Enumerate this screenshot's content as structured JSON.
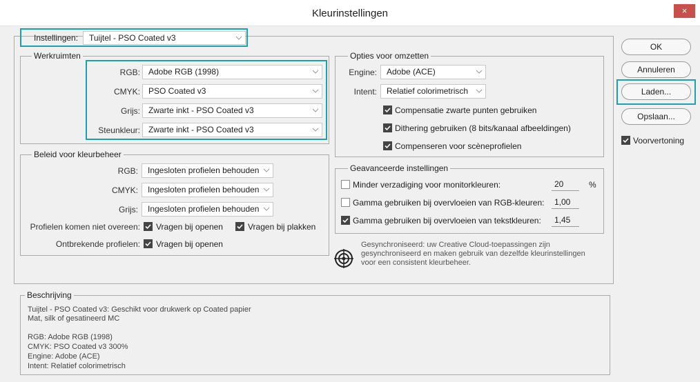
{
  "window": {
    "title": "Kleurinstellingen",
    "close_glyph": "×"
  },
  "settings": {
    "label": "Instellingen:",
    "value": "Tuijtel - PSO Coated v3"
  },
  "workspaces": {
    "title": "Werkruimten",
    "rows": [
      {
        "label": "RGB:",
        "value": "Adobe RGB (1998)"
      },
      {
        "label": "CMYK:",
        "value": "PSO Coated v3"
      },
      {
        "label": "Grijs:",
        "value": "Zwarte inkt - PSO Coated v3"
      },
      {
        "label": "Steunkleur:",
        "value": "Zwarte inkt - PSO Coated v3"
      }
    ]
  },
  "policy": {
    "title": "Beleid voor kleurbeheer",
    "rows": [
      {
        "label": "RGB:",
        "value": "Ingesloten profielen behouden"
      },
      {
        "label": "CMYK:",
        "value": "Ingesloten profielen behouden"
      },
      {
        "label": "Grijs:",
        "value": "Ingesloten profielen behouden"
      }
    ],
    "mismatch_label": "Profielen komen niet overeen:",
    "mismatch_open": {
      "label": "Vragen bij openen",
      "checked": true
    },
    "mismatch_paste": {
      "label": "Vragen bij plakken",
      "checked": true
    },
    "missing_label": "Ontbrekende profielen:",
    "missing_open": {
      "label": "Vragen bij openen",
      "checked": true
    }
  },
  "conversion": {
    "title": "Opties voor omzetten",
    "engine_label": "Engine:",
    "engine_value": "Adobe (ACE)",
    "intent_label": "Intent:",
    "intent_value": "Relatief colorimetrisch",
    "checks": [
      {
        "label": "Compensatie zwarte punten gebruiken",
        "checked": true
      },
      {
        "label": "Dithering gebruiken (8 bits/kanaal afbeeldingen)",
        "checked": true
      },
      {
        "label": "Compenseren voor scèneprofielen",
        "checked": true
      }
    ]
  },
  "advanced": {
    "title": "Geavanceerde instellingen",
    "rows": [
      {
        "label": "Minder verzadiging voor monitorkleuren:",
        "value": "20",
        "unit": "%",
        "checked": false
      },
      {
        "label": "Gamma gebruiken bij overvloeien van RGB-kleuren:",
        "value": "1,00",
        "unit": "",
        "checked": false
      },
      {
        "label": "Gamma gebruiken bij overvloeien van tekstkleuren:",
        "value": "1,45",
        "unit": "",
        "checked": true
      }
    ]
  },
  "sync": {
    "icon": "sync-target-icon",
    "lines": [
      "Gesynchroniseerd: uw Creative Cloud-toepassingen zijn",
      "gesynchroniseerd en maken gebruik van dezelfde kleurinstellingen",
      "voor een consistent kleurbeheer."
    ]
  },
  "description": {
    "title": "Beschrijving",
    "lines": [
      "Tuijtel - PSO Coated v3:  Geschikt voor drukwerk op Coated papier",
      "Mat, silk of gesatineerd MC",
      "",
      "RGB: Adobe RGB (1998)",
      "CMYK: PSO Coated v3 300%",
      "Engine: Adobe (ACE)",
      "Intent: Relatief colorimetrisch"
    ]
  },
  "buttons": {
    "ok": "OK",
    "cancel": "Annuleren",
    "load": "Laden...",
    "save": "Opslaan...",
    "preview": {
      "label": "Voorvertoning",
      "checked": true
    }
  },
  "colors": {
    "highlight": "#1aa1ad",
    "close": "#c7504a",
    "checkbox_on": "#444444"
  }
}
